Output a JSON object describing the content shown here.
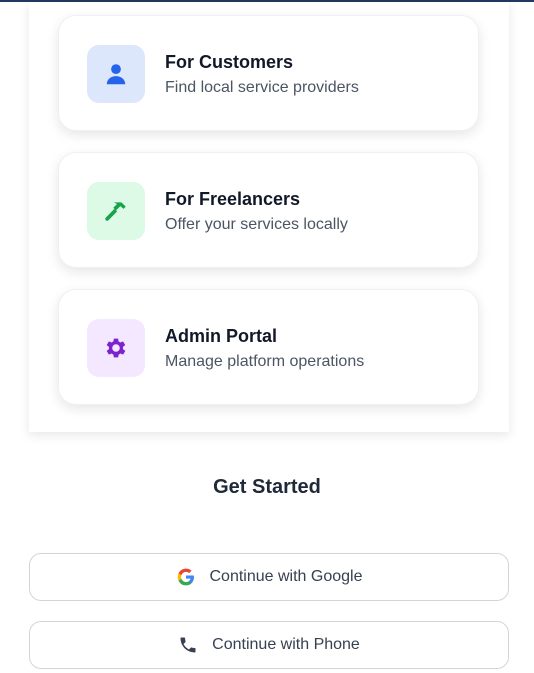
{
  "roles": [
    {
      "title": "For Customers",
      "subtitle": "Find local service providers",
      "icon": "user-icon",
      "icon_bg": "#dde7fb",
      "icon_color": "#2563eb"
    },
    {
      "title": "For Freelancers",
      "subtitle": "Offer your services locally",
      "icon": "hammer-icon",
      "icon_bg": "#dcfae6",
      "icon_color": "#16a34a"
    },
    {
      "title": "Admin Portal",
      "subtitle": "Manage platform operations",
      "icon": "gear-icon",
      "icon_bg": "#f3e8ff",
      "icon_color": "#7e22ce"
    }
  ],
  "auth": {
    "heading": "Get Started",
    "google_label": "Continue with Google",
    "google_icon": "google-icon",
    "phone_label": "Continue with Phone",
    "phone_icon": "phone-icon"
  },
  "colors": {
    "top_bar": "#1e3a5f",
    "button_border": "#d1d5db"
  }
}
